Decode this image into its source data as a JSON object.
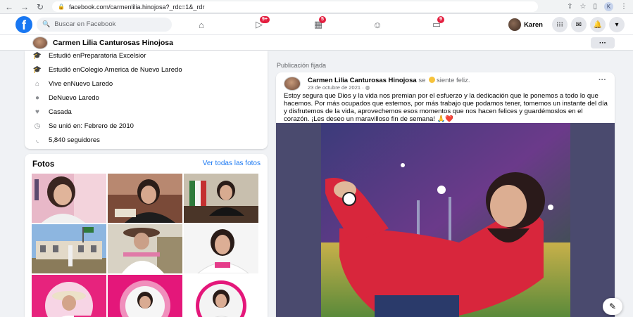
{
  "browser": {
    "url": "facebook.com/carmenlilia.hinojosa?_rdc=1&_rdr",
    "profile_initial": "K"
  },
  "header": {
    "search_placeholder": "Buscar en Facebook",
    "badges": {
      "watch": "9+",
      "marketplace": "5",
      "gaming": "9"
    },
    "user_name": "Karen"
  },
  "profile": {
    "name": "Carmen Lilia Canturosas Hinojosa",
    "more": "···"
  },
  "intro": {
    "items": [
      {
        "prefix": "Estudió en ",
        "value": "Preparatoria Excelsior"
      },
      {
        "prefix": "Estudió en ",
        "value": "Colegio America de Nuevo Laredo"
      },
      {
        "prefix": "Vive en ",
        "value": "Nuevo Laredo"
      },
      {
        "prefix": "De ",
        "value": "Nuevo Laredo"
      },
      {
        "prefix": "",
        "value": "Casada"
      },
      {
        "prefix": "",
        "value": "Se unió en: Febrero de 2010"
      },
      {
        "prefix": "",
        "value": "5,840 seguidores"
      }
    ]
  },
  "photos": {
    "title": "Fotos",
    "see_all": "Ver todas las fotos"
  },
  "post": {
    "pinned_label": "Publicación fijada",
    "author": "Carmen Lilia Canturosas Hinojosa",
    "feeling_prefix": " se ",
    "feeling": "siente feliz.",
    "date": "23 de octubre de 2021 · ",
    "more": "···",
    "text": "Estoy segura que Dios y la vida nos premian por el esfuerzo y la dedicación que le ponemos a todo lo que hacemos. Por más ocupados que estemos, por más trabajo que podamos tener, tomemos un instante del día y disfrutemos de la vida, aprovechemos esos momentos que nos hacen felices y guardémoslos en el corazón. ¡Les deseo un maravilloso fin de semana! 🙏❤️"
  },
  "colors": {
    "fb_blue": "#1877f2",
    "badge_red": "#e41e3f",
    "page_bg": "#f0f2f5"
  }
}
